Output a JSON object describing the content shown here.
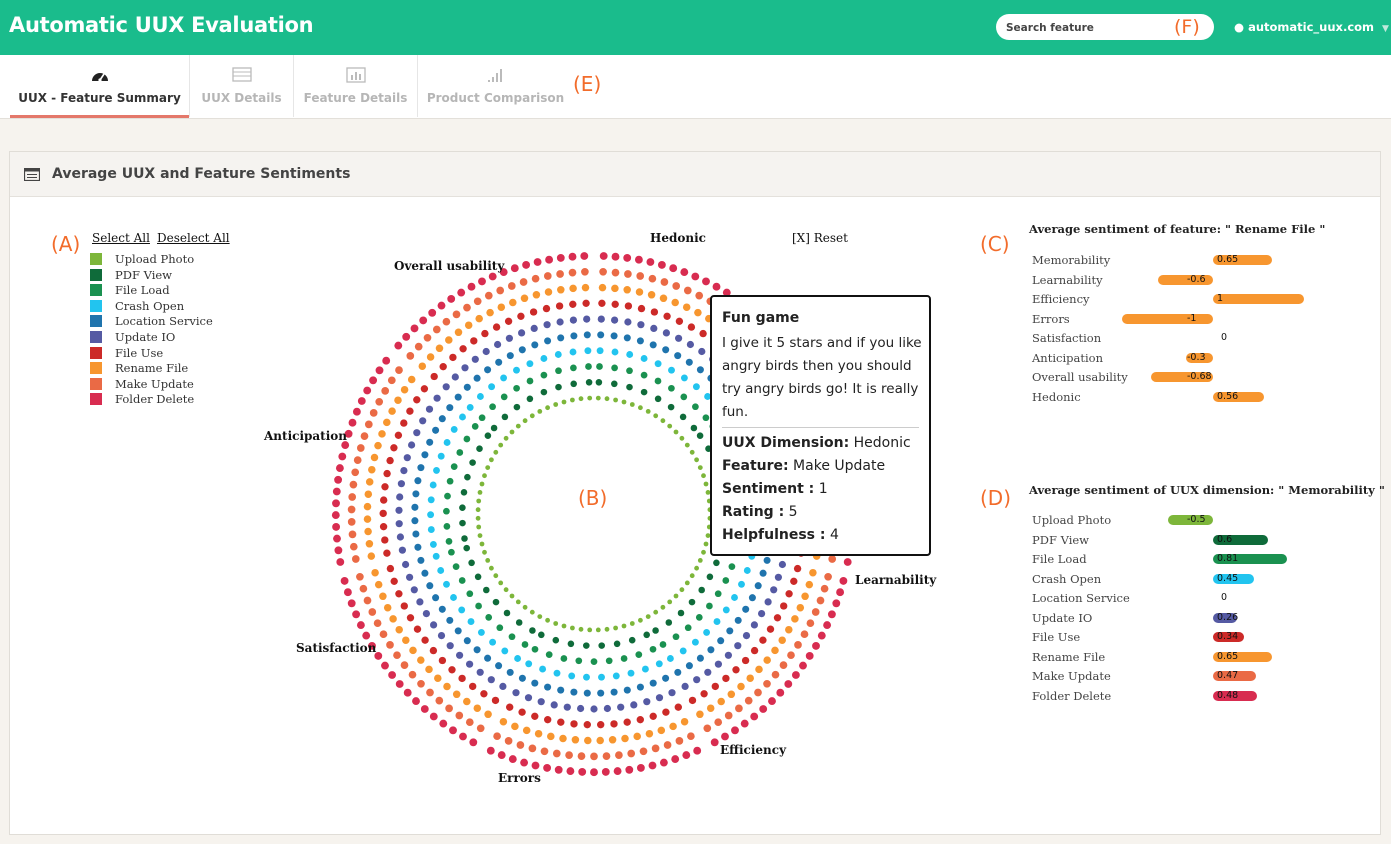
{
  "app": {
    "title": "Automatic UUX Evaluation",
    "search_placeholder": "Search feature",
    "search_marker": "(F)",
    "user": "automatic_uux.com"
  },
  "tabs": [
    {
      "label": "UUX - Feature Summary",
      "icon": "dashboard-icon",
      "active": true
    },
    {
      "label": "UUX Details",
      "icon": "table-icon",
      "active": false
    },
    {
      "label": "Feature Details",
      "icon": "bar-chart-icon",
      "active": false
    },
    {
      "label": "Product Comparison",
      "icon": "signal-icon",
      "active": false
    }
  ],
  "tabs_marker": "(E)",
  "panel": {
    "title": "Average UUX and Feature Sentiments",
    "icon": "list-icon"
  },
  "markers": {
    "a": "(A)",
    "b": "(B)",
    "c": "(C)",
    "d": "(D)"
  },
  "legend": {
    "select_all": "Select All",
    "deselect_all": "Deselect All",
    "items": [
      {
        "label": "Upload Photo",
        "color": "#7db63a"
      },
      {
        "label": "PDF View",
        "color": "#0f6b3a"
      },
      {
        "label": "File Load",
        "color": "#1a9150"
      },
      {
        "label": "Crash Open",
        "color": "#22c4ef"
      },
      {
        "label": "Location Service",
        "color": "#1f74ad"
      },
      {
        "label": "Update IO",
        "color": "#555aa3"
      },
      {
        "label": "File Use",
        "color": "#cc2a28"
      },
      {
        "label": "Rename File",
        "color": "#f7962f"
      },
      {
        "label": "Make Update",
        "color": "#ea6a45"
      },
      {
        "label": "Folder Delete",
        "color": "#d82c50"
      }
    ]
  },
  "reset": "[X] Reset",
  "dimensions": [
    "Hedonic",
    "Learnability",
    "Efficiency",
    "Errors",
    "Satisfaction",
    "Anticipation",
    "Overall usability"
  ],
  "tooltip": {
    "title": "Fun game",
    "body": "I give it 5 stars and if you like angry birds then you should try angry birds go! It is really fun.",
    "rows": [
      {
        "key": "UUX Dimension:",
        "value": " Hedonic"
      },
      {
        "key": "Feature:",
        "value": " Make Update"
      },
      {
        "key": "Sentiment :",
        "value": " 1"
      },
      {
        "key": "Rating :",
        "value": " 5"
      },
      {
        "key": "Helpfulness :",
        "value": " 4"
      }
    ]
  },
  "chart_data": [
    {
      "type": "bar",
      "title": "Average sentiment of feature: \" Rename File \"",
      "categories": [
        "Memorability",
        "Learnability",
        "Efficiency",
        "Errors",
        "Satisfaction",
        "Anticipation",
        "Overall usability",
        "Hedonic"
      ],
      "values": [
        0.65,
        -0.6,
        1,
        -1,
        0,
        -0.3,
        -0.68,
        0.56
      ],
      "value_labels": [
        "0.65",
        "-0.6",
        "1",
        "-1",
        "0",
        "-0.3",
        "-0.68",
        "0.56"
      ],
      "colors": [
        "#f7962f",
        "#f7962f",
        "#f7962f",
        "#f7962f",
        "#f7962f",
        "#f7962f",
        "#f7962f",
        "#f7962f"
      ],
      "xlim": [
        -1,
        1
      ]
    },
    {
      "type": "bar",
      "title": "Average sentiment of UUX dimension: \" Memorability \"",
      "categories": [
        "Upload Photo",
        "PDF View",
        "File Load",
        "Crash Open",
        "Location Service",
        "Update IO",
        "File Use",
        "Rename File",
        "Make Update",
        "Folder Delete"
      ],
      "values": [
        -0.5,
        0.6,
        0.81,
        0.45,
        0,
        0.26,
        0.34,
        0.65,
        0.47,
        0.48
      ],
      "value_labels": [
        "-0.5",
        "0.6",
        "0.81",
        "0.45",
        "0",
        "0.26",
        "0.34",
        "0.65",
        "0.47",
        "0.48"
      ],
      "colors": [
        "#7db63a",
        "#0f6b3a",
        "#1a9150",
        "#22c4ef",
        "#1f74ad",
        "#555aa3",
        "#cc2a28",
        "#f7962f",
        "#ea6a45",
        "#d82c50"
      ],
      "xlim": [
        -1,
        1
      ]
    }
  ]
}
